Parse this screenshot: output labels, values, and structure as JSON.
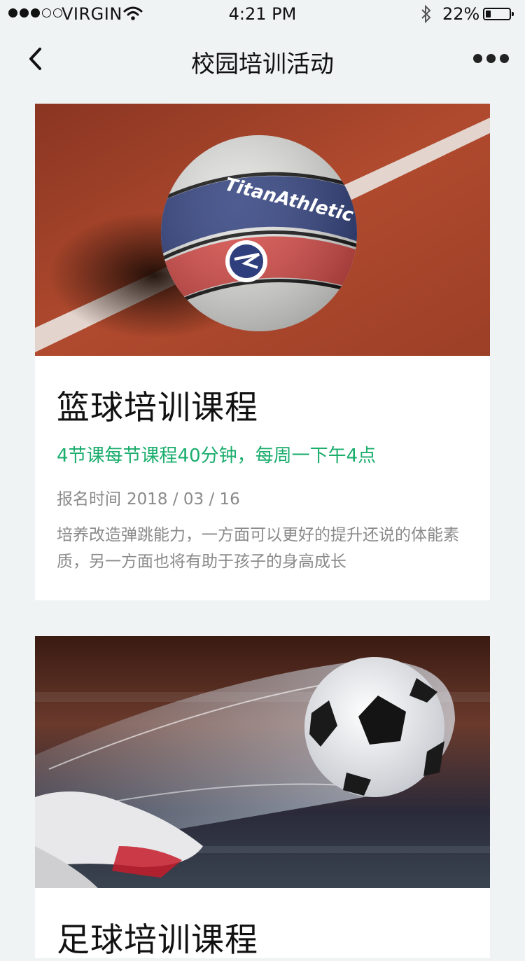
{
  "status_bar": {
    "carrier": "VIRGIN",
    "time": "4:21 PM",
    "battery_percent": "22%",
    "battery_level": 0.22,
    "signal_bars_filled": 3,
    "signal_bars_total": 5
  },
  "nav": {
    "title": "校园培训活动",
    "back_icon": "chevron-left-icon",
    "more_icon": "more-dots-icon"
  },
  "courses": [
    {
      "title": "篮球培训课程",
      "schedule": "4节课每节课程40分钟，每周一下午4点",
      "date_label": "报名时间",
      "date_value": "2018 / 03 / 16",
      "description": "培养改造弹跳能力，一方面可以更好的提升还说的体能素质，另一方面也将有助于孩子的身高成长",
      "image_brand": "TitanAthletic"
    },
    {
      "title": "足球培训课程"
    }
  ],
  "colors": {
    "accent": "#1aad6c",
    "background": "#f0f3f4",
    "muted_text": "#8a8a8a"
  }
}
